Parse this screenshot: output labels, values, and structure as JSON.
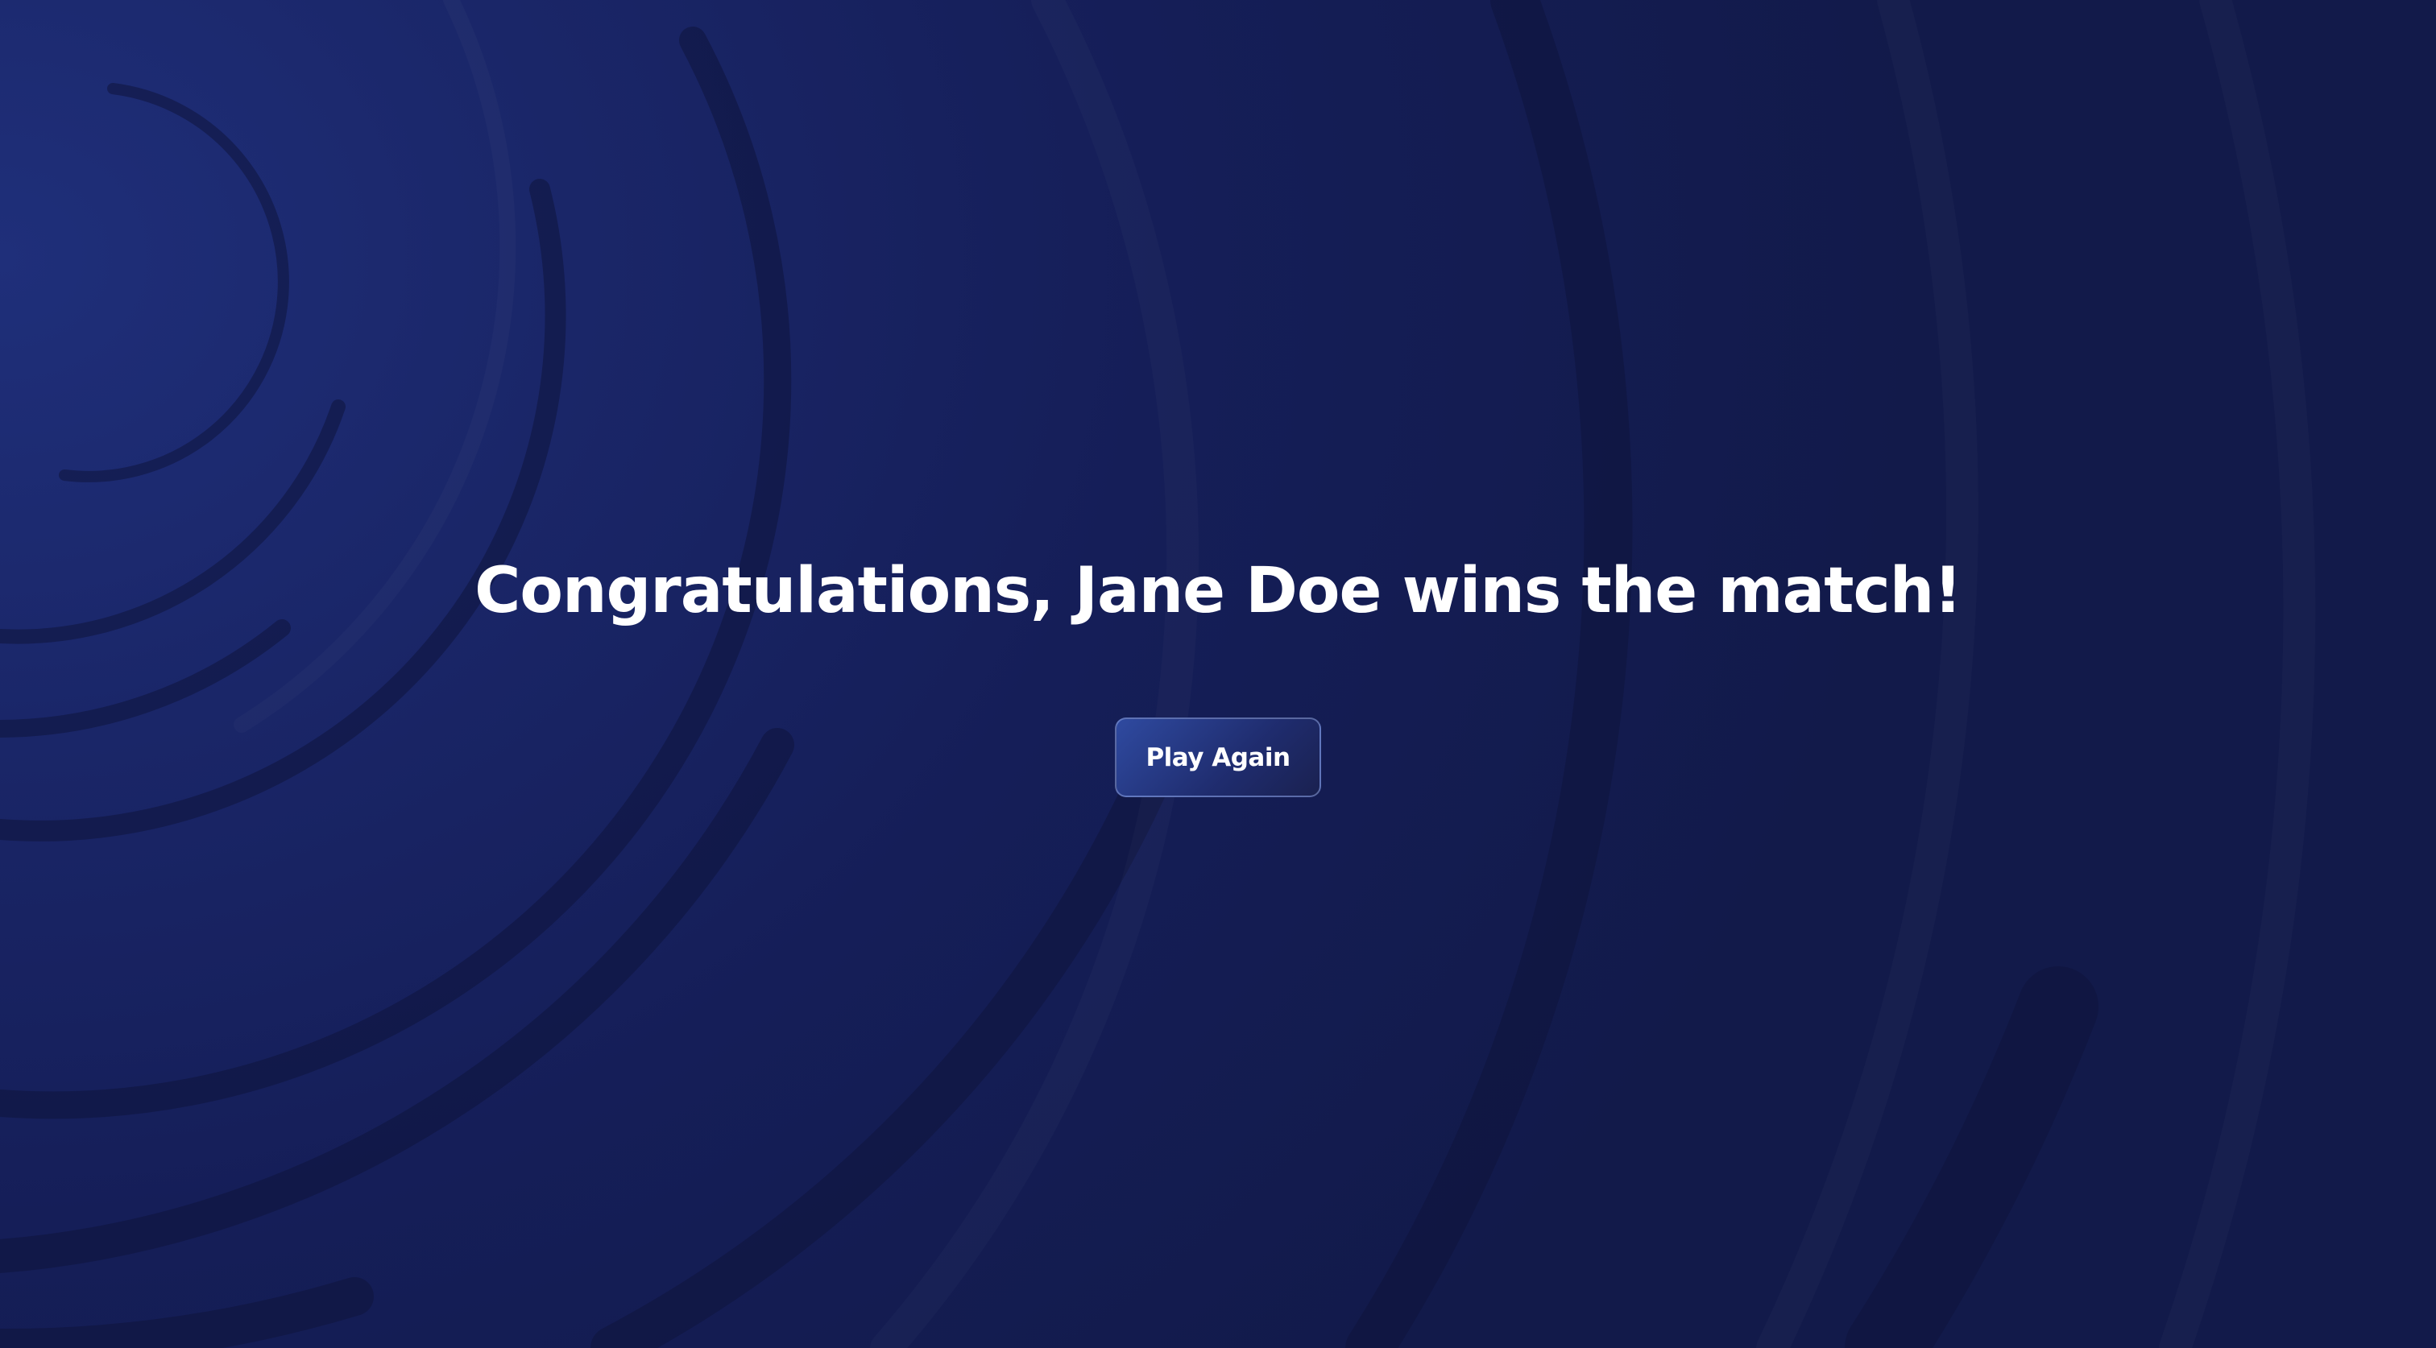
{
  "result": {
    "message": "Congratulations, Jane Doe wins the match!",
    "play_again_label": "Play Again"
  },
  "colors": {
    "background": "#1a2668",
    "background_dark": "#121a4a",
    "text": "#ffffff",
    "button_start": "#2f4aa0",
    "button_end": "#1a2150"
  }
}
